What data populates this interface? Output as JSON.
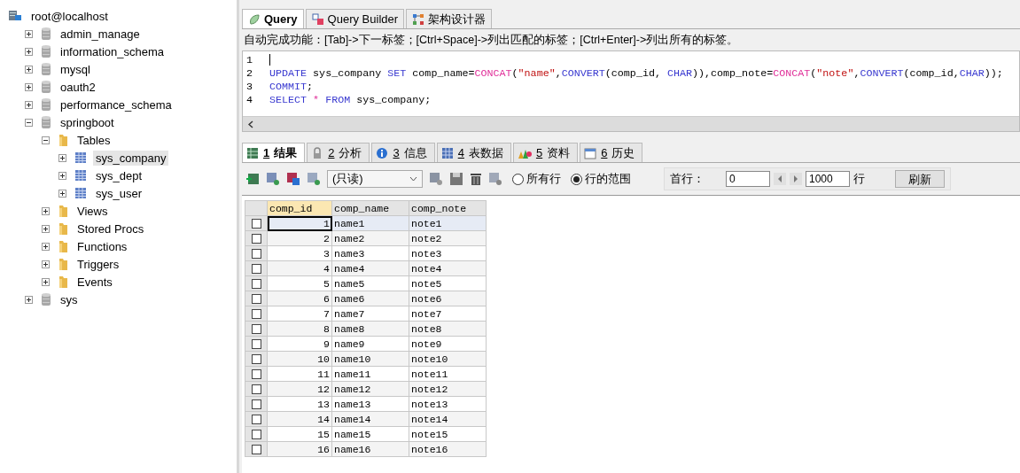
{
  "tree": {
    "label": "root@localhost",
    "kind": "server",
    "children": [
      {
        "label": "admin_manage",
        "kind": "database",
        "expanded": false,
        "selected": false
      },
      {
        "label": "information_schema",
        "kind": "database",
        "expanded": false,
        "selected": false
      },
      {
        "label": "mysql",
        "kind": "database",
        "expanded": false,
        "selected": false
      },
      {
        "label": "oauth2",
        "kind": "database",
        "expanded": false,
        "selected": false
      },
      {
        "label": "performance_schema",
        "kind": "database",
        "expanded": false,
        "selected": false
      },
      {
        "label": "springboot",
        "kind": "database",
        "expanded": true,
        "selected": false,
        "children": [
          {
            "label": "Tables",
            "kind": "folder",
            "expanded": true,
            "selected": false,
            "children": [
              {
                "label": "sys_company",
                "kind": "table",
                "expanded": false,
                "selected": true
              },
              {
                "label": "sys_dept",
                "kind": "table",
                "expanded": false,
                "selected": false
              },
              {
                "label": "sys_user",
                "kind": "table",
                "expanded": false,
                "selected": false
              }
            ]
          },
          {
            "label": "Views",
            "kind": "folder",
            "expanded": false,
            "selected": false
          },
          {
            "label": "Stored Procs",
            "kind": "folder",
            "expanded": false,
            "selected": false
          },
          {
            "label": "Functions",
            "kind": "folder",
            "expanded": false,
            "selected": false
          },
          {
            "label": "Triggers",
            "kind": "folder",
            "expanded": false,
            "selected": false
          },
          {
            "label": "Events",
            "kind": "folder",
            "expanded": false,
            "selected": false
          }
        ]
      },
      {
        "label": "sys",
        "kind": "database",
        "expanded": false,
        "selected": false
      }
    ]
  },
  "editor_tabs": [
    {
      "label": "Query",
      "kind": "query",
      "selected": true
    },
    {
      "label": "Query Builder",
      "kind": "builder",
      "selected": false
    },
    {
      "label": "架构设计器",
      "kind": "schema",
      "selected": false
    }
  ],
  "hint": "自动完成功能：[Tab]->下一标签；[Ctrl+Space]->列出匹配的标签；[Ctrl+Enter]->列出所有的标签。",
  "code_lines": [
    {
      "number": "1"
    },
    {
      "number": "2",
      "tokens": [
        {
          "kind": "keyword",
          "text": "UPDATE"
        },
        {
          "kind": "plain",
          "text": " sys_company "
        },
        {
          "kind": "keyword",
          "text": "SET"
        },
        {
          "kind": "plain",
          "text": " comp_name="
        },
        {
          "kind": "function",
          "text": "CONCAT"
        },
        {
          "kind": "plain",
          "text": "("
        },
        {
          "kind": "string",
          "text": "\"name\""
        },
        {
          "kind": "plain",
          "text": ","
        },
        {
          "kind": "keyword",
          "text": "CONVERT"
        },
        {
          "kind": "plain",
          "text": "(comp_id, "
        },
        {
          "kind": "keyword",
          "text": "CHAR"
        },
        {
          "kind": "plain",
          "text": ")),comp_note="
        },
        {
          "kind": "function",
          "text": "CONCAT"
        },
        {
          "kind": "plain",
          "text": "("
        },
        {
          "kind": "string",
          "text": "\"note\""
        },
        {
          "kind": "plain",
          "text": ","
        },
        {
          "kind": "keyword",
          "text": "CONVERT"
        },
        {
          "kind": "plain",
          "text": "(comp_id,"
        },
        {
          "kind": "keyword",
          "text": "CHAR"
        },
        {
          "kind": "plain",
          "text": "));"
        }
      ]
    },
    {
      "number": "3",
      "tokens": [
        {
          "kind": "keyword",
          "text": "COMMIT"
        },
        {
          "kind": "plain",
          "text": ";"
        }
      ]
    },
    {
      "number": "4",
      "tokens": [
        {
          "kind": "keyword",
          "text": "SELECT"
        },
        {
          "kind": "function",
          "text": " * "
        },
        {
          "kind": "keyword",
          "text": "FROM"
        },
        {
          "kind": "plain",
          "text": " sys_company;"
        }
      ]
    }
  ],
  "result_tabs": [
    {
      "number": "1",
      "label": "结果",
      "kind": "result",
      "selected": true
    },
    {
      "number": "2",
      "label": "分析",
      "kind": "profile",
      "selected": false
    },
    {
      "number": "3",
      "label": "信息",
      "kind": "info",
      "selected": false
    },
    {
      "number": "4",
      "label": "表数据",
      "kind": "tabledata",
      "selected": false
    },
    {
      "number": "5",
      "label": "资料",
      "kind": "chart",
      "selected": false
    },
    {
      "number": "6",
      "label": "历史",
      "kind": "history",
      "selected": false
    }
  ],
  "toolbar": {
    "mode": "(只读)",
    "row_options": [
      {
        "label": "所有行",
        "selected": false
      },
      {
        "label": "行的范围",
        "selected": true
      }
    ],
    "first_row_label": "首行：",
    "first_row": "0",
    "row_count": "1000",
    "rows_label": "行",
    "refresh": "刷新"
  },
  "grid": {
    "columns": [
      "comp_id",
      "comp_name",
      "comp_note"
    ],
    "rows": [
      {
        "cells": [
          "1",
          "name1",
          "note1"
        ],
        "checked": false,
        "selected": true
      },
      {
        "cells": [
          "2",
          "name2",
          "note2"
        ],
        "checked": false,
        "selected": false
      },
      {
        "cells": [
          "3",
          "name3",
          "note3"
        ],
        "checked": false,
        "selected": false
      },
      {
        "cells": [
          "4",
          "name4",
          "note4"
        ],
        "checked": false,
        "selected": false
      },
      {
        "cells": [
          "5",
          "name5",
          "note5"
        ],
        "checked": false,
        "selected": false
      },
      {
        "cells": [
          "6",
          "name6",
          "note6"
        ],
        "checked": false,
        "selected": false
      },
      {
        "cells": [
          "7",
          "name7",
          "note7"
        ],
        "checked": false,
        "selected": false
      },
      {
        "cells": [
          "8",
          "name8",
          "note8"
        ],
        "checked": false,
        "selected": false
      },
      {
        "cells": [
          "9",
          "name9",
          "note9"
        ],
        "checked": false,
        "selected": false
      },
      {
        "cells": [
          "10",
          "name10",
          "note10"
        ],
        "checked": false,
        "selected": false
      },
      {
        "cells": [
          "11",
          "name11",
          "note11"
        ],
        "checked": false,
        "selected": false
      },
      {
        "cells": [
          "12",
          "name12",
          "note12"
        ],
        "checked": false,
        "selected": false
      },
      {
        "cells": [
          "13",
          "name13",
          "note13"
        ],
        "checked": false,
        "selected": false
      },
      {
        "cells": [
          "14",
          "name14",
          "note14"
        ],
        "checked": false,
        "selected": false
      },
      {
        "cells": [
          "15",
          "name15",
          "note15"
        ],
        "checked": false,
        "selected": false
      },
      {
        "cells": [
          "16",
          "name16",
          "note16"
        ],
        "checked": false,
        "selected": false
      }
    ]
  }
}
